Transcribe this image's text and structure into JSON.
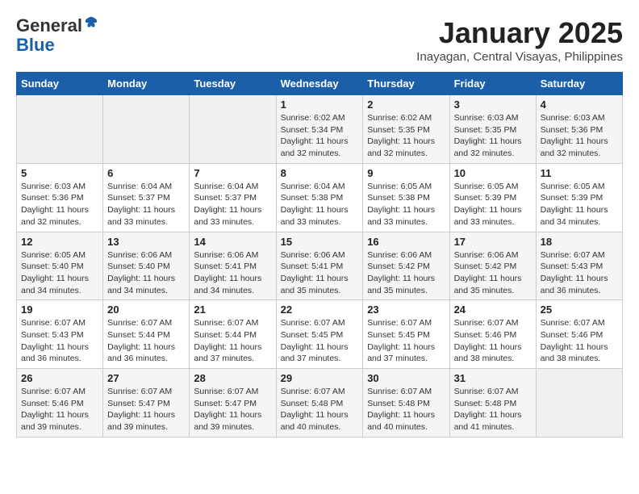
{
  "header": {
    "logo_general": "General",
    "logo_blue": "Blue",
    "month_title": "January 2025",
    "location": "Inayagan, Central Visayas, Philippines"
  },
  "days_of_week": [
    "Sunday",
    "Monday",
    "Tuesday",
    "Wednesday",
    "Thursday",
    "Friday",
    "Saturday"
  ],
  "weeks": [
    [
      {
        "day": "",
        "info": ""
      },
      {
        "day": "",
        "info": ""
      },
      {
        "day": "",
        "info": ""
      },
      {
        "day": "1",
        "info": "Sunrise: 6:02 AM\nSunset: 5:34 PM\nDaylight: 11 hours and 32 minutes."
      },
      {
        "day": "2",
        "info": "Sunrise: 6:02 AM\nSunset: 5:35 PM\nDaylight: 11 hours and 32 minutes."
      },
      {
        "day": "3",
        "info": "Sunrise: 6:03 AM\nSunset: 5:35 PM\nDaylight: 11 hours and 32 minutes."
      },
      {
        "day": "4",
        "info": "Sunrise: 6:03 AM\nSunset: 5:36 PM\nDaylight: 11 hours and 32 minutes."
      }
    ],
    [
      {
        "day": "5",
        "info": "Sunrise: 6:03 AM\nSunset: 5:36 PM\nDaylight: 11 hours and 32 minutes."
      },
      {
        "day": "6",
        "info": "Sunrise: 6:04 AM\nSunset: 5:37 PM\nDaylight: 11 hours and 33 minutes."
      },
      {
        "day": "7",
        "info": "Sunrise: 6:04 AM\nSunset: 5:37 PM\nDaylight: 11 hours and 33 minutes."
      },
      {
        "day": "8",
        "info": "Sunrise: 6:04 AM\nSunset: 5:38 PM\nDaylight: 11 hours and 33 minutes."
      },
      {
        "day": "9",
        "info": "Sunrise: 6:05 AM\nSunset: 5:38 PM\nDaylight: 11 hours and 33 minutes."
      },
      {
        "day": "10",
        "info": "Sunrise: 6:05 AM\nSunset: 5:39 PM\nDaylight: 11 hours and 33 minutes."
      },
      {
        "day": "11",
        "info": "Sunrise: 6:05 AM\nSunset: 5:39 PM\nDaylight: 11 hours and 34 minutes."
      }
    ],
    [
      {
        "day": "12",
        "info": "Sunrise: 6:05 AM\nSunset: 5:40 PM\nDaylight: 11 hours and 34 minutes."
      },
      {
        "day": "13",
        "info": "Sunrise: 6:06 AM\nSunset: 5:40 PM\nDaylight: 11 hours and 34 minutes."
      },
      {
        "day": "14",
        "info": "Sunrise: 6:06 AM\nSunset: 5:41 PM\nDaylight: 11 hours and 34 minutes."
      },
      {
        "day": "15",
        "info": "Sunrise: 6:06 AM\nSunset: 5:41 PM\nDaylight: 11 hours and 35 minutes."
      },
      {
        "day": "16",
        "info": "Sunrise: 6:06 AM\nSunset: 5:42 PM\nDaylight: 11 hours and 35 minutes."
      },
      {
        "day": "17",
        "info": "Sunrise: 6:06 AM\nSunset: 5:42 PM\nDaylight: 11 hours and 35 minutes."
      },
      {
        "day": "18",
        "info": "Sunrise: 6:07 AM\nSunset: 5:43 PM\nDaylight: 11 hours and 36 minutes."
      }
    ],
    [
      {
        "day": "19",
        "info": "Sunrise: 6:07 AM\nSunset: 5:43 PM\nDaylight: 11 hours and 36 minutes."
      },
      {
        "day": "20",
        "info": "Sunrise: 6:07 AM\nSunset: 5:44 PM\nDaylight: 11 hours and 36 minutes."
      },
      {
        "day": "21",
        "info": "Sunrise: 6:07 AM\nSunset: 5:44 PM\nDaylight: 11 hours and 37 minutes."
      },
      {
        "day": "22",
        "info": "Sunrise: 6:07 AM\nSunset: 5:45 PM\nDaylight: 11 hours and 37 minutes."
      },
      {
        "day": "23",
        "info": "Sunrise: 6:07 AM\nSunset: 5:45 PM\nDaylight: 11 hours and 37 minutes."
      },
      {
        "day": "24",
        "info": "Sunrise: 6:07 AM\nSunset: 5:46 PM\nDaylight: 11 hours and 38 minutes."
      },
      {
        "day": "25",
        "info": "Sunrise: 6:07 AM\nSunset: 5:46 PM\nDaylight: 11 hours and 38 minutes."
      }
    ],
    [
      {
        "day": "26",
        "info": "Sunrise: 6:07 AM\nSunset: 5:46 PM\nDaylight: 11 hours and 39 minutes."
      },
      {
        "day": "27",
        "info": "Sunrise: 6:07 AM\nSunset: 5:47 PM\nDaylight: 11 hours and 39 minutes."
      },
      {
        "day": "28",
        "info": "Sunrise: 6:07 AM\nSunset: 5:47 PM\nDaylight: 11 hours and 39 minutes."
      },
      {
        "day": "29",
        "info": "Sunrise: 6:07 AM\nSunset: 5:48 PM\nDaylight: 11 hours and 40 minutes."
      },
      {
        "day": "30",
        "info": "Sunrise: 6:07 AM\nSunset: 5:48 PM\nDaylight: 11 hours and 40 minutes."
      },
      {
        "day": "31",
        "info": "Sunrise: 6:07 AM\nSunset: 5:48 PM\nDaylight: 11 hours and 41 minutes."
      },
      {
        "day": "",
        "info": ""
      }
    ]
  ]
}
